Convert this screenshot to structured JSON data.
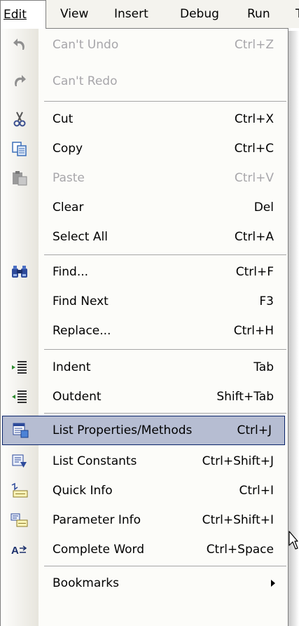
{
  "menubar": {
    "items": [
      {
        "label": "Edit",
        "active": true
      },
      {
        "label": "View"
      },
      {
        "label": "Insert"
      },
      {
        "label": "Debug"
      },
      {
        "label": "Run"
      },
      {
        "label": "T"
      }
    ]
  },
  "menu": {
    "items": [
      {
        "label": "Can't Undo",
        "shortcut": "Ctrl+Z",
        "icon": "undo-icon",
        "disabled": true
      },
      {
        "label": "Can't Redo",
        "shortcut": "",
        "icon": "redo-icon",
        "disabled": true
      },
      {
        "label": "Cut",
        "shortcut": "Ctrl+X",
        "icon": "scissors-icon"
      },
      {
        "label": "Copy",
        "shortcut": "Ctrl+C",
        "icon": "copy-icon"
      },
      {
        "label": "Paste",
        "shortcut": "Ctrl+V",
        "icon": "paste-icon",
        "disabled": true
      },
      {
        "label": "Clear",
        "shortcut": "Del"
      },
      {
        "label": "Select All",
        "shortcut": "Ctrl+A"
      },
      {
        "label": "Find...",
        "shortcut": "Ctrl+F",
        "icon": "binoculars-icon"
      },
      {
        "label": "Find Next",
        "shortcut": "F3"
      },
      {
        "label": "Replace...",
        "shortcut": "Ctrl+H"
      },
      {
        "label": "Indent",
        "shortcut": "Tab",
        "icon": "indent-icon"
      },
      {
        "label": "Outdent",
        "shortcut": "Shift+Tab",
        "icon": "outdent-icon"
      },
      {
        "label": "List Properties/Methods",
        "shortcut": "Ctrl+J",
        "icon": "list-properties-icon",
        "highlighted": true
      },
      {
        "label": "List Constants",
        "shortcut": "Ctrl+Shift+J",
        "icon": "list-constants-icon"
      },
      {
        "label": "Quick Info",
        "shortcut": "Ctrl+I",
        "icon": "quick-info-icon"
      },
      {
        "label": "Parameter Info",
        "shortcut": "Ctrl+Shift+I",
        "icon": "parameter-info-icon"
      },
      {
        "label": "Complete Word",
        "shortcut": "Ctrl+Space",
        "icon": "complete-word-icon"
      },
      {
        "label": "Bookmarks",
        "shortcut": "",
        "submenu": true
      }
    ]
  },
  "colors": {
    "highlight_bg": "#b6bdd2",
    "highlight_border": "#0a246a",
    "disabled_text": "#a7a6aa"
  }
}
